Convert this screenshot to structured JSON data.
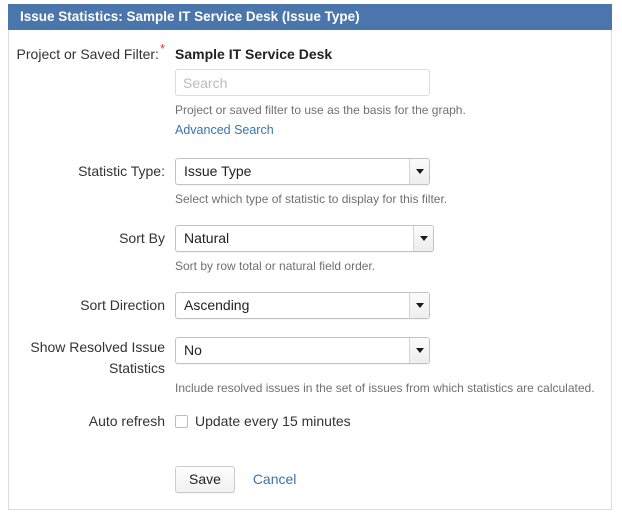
{
  "panel": {
    "title": "Issue Statistics: Sample IT Service Desk (Issue Type)",
    "header_bg": "#4a76ab",
    "link_color": "#3b73af",
    "required_color": "#d04437"
  },
  "fields": {
    "project_filter": {
      "label": "Project or Saved Filter:",
      "required_marker": "*",
      "value": "Sample IT Service Desk",
      "search_placeholder": "Search",
      "search_value": "",
      "description": "Project or saved filter to use as the basis for the graph.",
      "advanced_search_label": "Advanced Search"
    },
    "statistic_type": {
      "label": "Statistic Type:",
      "selected": "Issue Type",
      "description": "Select which type of statistic to display for this filter."
    },
    "sort_by": {
      "label": "Sort By",
      "selected": "Natural",
      "description": "Sort by row total or natural field order."
    },
    "sort_direction": {
      "label": "Sort Direction",
      "selected": "Ascending",
      "description": ""
    },
    "show_resolved": {
      "label": "Show Resolved Issue Statistics",
      "selected": "No",
      "description": "Include resolved issues in the set of issues from which statistics are calculated."
    },
    "auto_refresh": {
      "label": "Auto refresh",
      "checkbox_label": "Update every 15 minutes",
      "checked": false
    }
  },
  "actions": {
    "save_label": "Save",
    "cancel_label": "Cancel"
  }
}
